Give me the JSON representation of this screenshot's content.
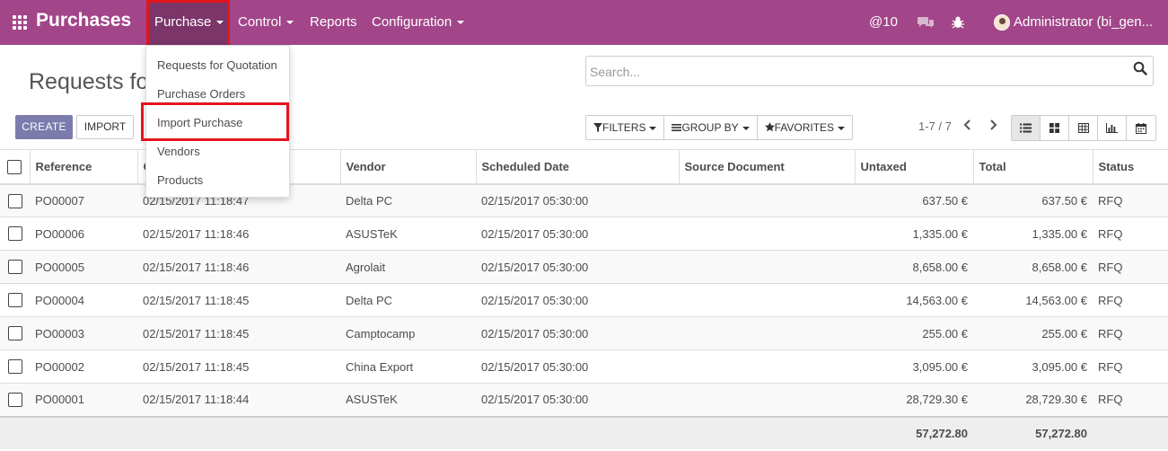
{
  "app": {
    "brand": "Purchases"
  },
  "nav": {
    "menus": [
      {
        "label": "Purchase",
        "active": true
      },
      {
        "label": "Control"
      },
      {
        "label": "Reports"
      },
      {
        "label": "Configuration"
      }
    ],
    "mentions": "@10",
    "user": "Administrator (bi_gen..."
  },
  "dropdown": {
    "items": [
      "Requests for Quotation",
      "Purchase Orders",
      "Import Purchase",
      "Vendors",
      "Products"
    ],
    "highlighted": "Import Purchase"
  },
  "page": {
    "title": "Requests fo"
  },
  "search": {
    "placeholder": "Search..."
  },
  "buttons": {
    "create": "CREATE",
    "import": "IMPORT"
  },
  "search_options": {
    "filters": "FILTERS",
    "group_by": "GROUP BY",
    "favorites": "FAVORITES"
  },
  "pager": {
    "text": "1-7 / 7"
  },
  "table": {
    "columns": [
      "Reference",
      "Order Date",
      "Vendor",
      "Scheduled Date",
      "Source Document",
      "Untaxed",
      "Total",
      "Status"
    ],
    "rows": [
      {
        "ref": "PO00007",
        "date": "02/15/2017 11:18:47",
        "vendor": "Delta PC",
        "scheduled": "02/15/2017 05:30:00",
        "source": "",
        "untaxed": "637.50 €",
        "total": "637.50 €",
        "status": "RFQ"
      },
      {
        "ref": "PO00006",
        "date": "02/15/2017 11:18:46",
        "vendor": "ASUSTeK",
        "scheduled": "02/15/2017 05:30:00",
        "source": "",
        "untaxed": "1,335.00 €",
        "total": "1,335.00 €",
        "status": "RFQ"
      },
      {
        "ref": "PO00005",
        "date": "02/15/2017 11:18:46",
        "vendor": "Agrolait",
        "scheduled": "02/15/2017 05:30:00",
        "source": "",
        "untaxed": "8,658.00 €",
        "total": "8,658.00 €",
        "status": "RFQ"
      },
      {
        "ref": "PO00004",
        "date": "02/15/2017 11:18:45",
        "vendor": "Delta PC",
        "scheduled": "02/15/2017 05:30:00",
        "source": "",
        "untaxed": "14,563.00 €",
        "total": "14,563.00 €",
        "status": "RFQ"
      },
      {
        "ref": "PO00003",
        "date": "02/15/2017 11:18:45",
        "vendor": "Camptocamp",
        "scheduled": "02/15/2017 05:30:00",
        "source": "",
        "untaxed": "255.00 €",
        "total": "255.00 €",
        "status": "RFQ"
      },
      {
        "ref": "PO00002",
        "date": "02/15/2017 11:18:45",
        "vendor": "China Export",
        "scheduled": "02/15/2017 05:30:00",
        "source": "",
        "untaxed": "3,095.00 €",
        "total": "3,095.00 €",
        "status": "RFQ"
      },
      {
        "ref": "PO00001",
        "date": "02/15/2017 11:18:44",
        "vendor": "ASUSTeK",
        "scheduled": "02/15/2017 05:30:00",
        "source": "",
        "untaxed": "28,729.30 €",
        "total": "28,729.30 €",
        "status": "RFQ"
      }
    ],
    "totals": {
      "untaxed": "57,272.80",
      "total": "57,272.80"
    }
  },
  "colors": {
    "navbar": "#a24689",
    "navbar_active": "#7b3569",
    "primary_button": "#7c7bad",
    "highlight": "#e3151c"
  }
}
